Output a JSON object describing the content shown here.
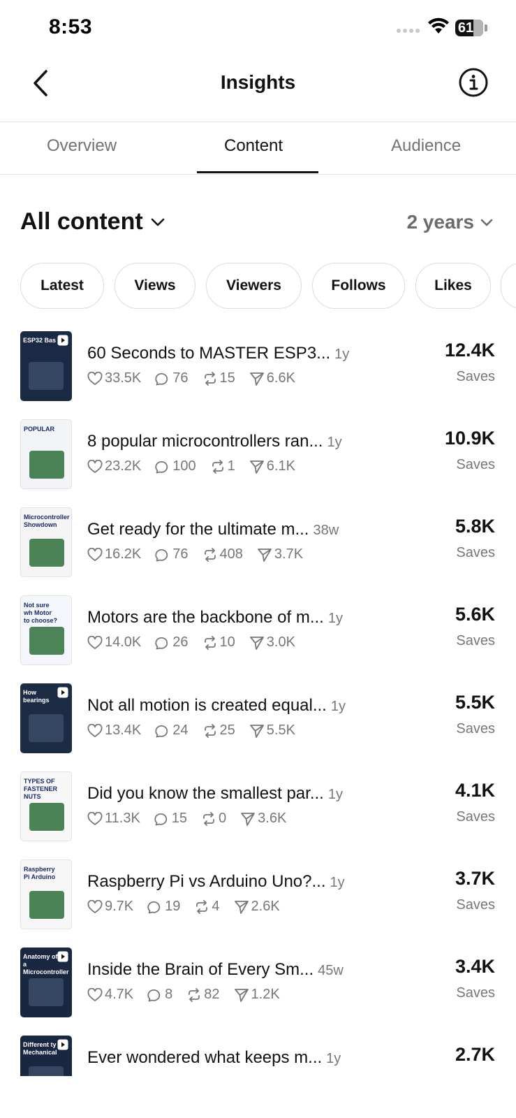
{
  "status": {
    "time": "8:53",
    "battery": "61"
  },
  "header": {
    "title": "Insights"
  },
  "tabs": [
    {
      "label": "Overview"
    },
    {
      "label": "Content"
    },
    {
      "label": "Audience"
    }
  ],
  "section": {
    "title": "All content",
    "range": "2 years"
  },
  "chips": [
    {
      "label": "Latest"
    },
    {
      "label": "Views"
    },
    {
      "label": "Viewers"
    },
    {
      "label": "Follows"
    },
    {
      "label": "Likes"
    }
  ],
  "rows": [
    {
      "title": "60 Seconds to MASTER ESP3...",
      "age": "1y",
      "likes": "33.5K",
      "comments": "76",
      "reposts": "15",
      "shares": "6.6K",
      "value": "12.4K",
      "metric": "Saves",
      "thumb_text": "ESP32 Bas",
      "thumb_bg": "#1b2a44"
    },
    {
      "title": "8 popular microcontrollers ran...",
      "age": "1y",
      "likes": "23.2K",
      "comments": "100",
      "reposts": "1",
      "shares": "6.1K",
      "value": "10.9K",
      "metric": "Saves",
      "thumb_text": "POPULAR",
      "thumb_bg": "#f2f4f7"
    },
    {
      "title": "Get ready for the ultimate m...",
      "age": "38w",
      "likes": "16.2K",
      "comments": "76",
      "reposts": "408",
      "shares": "3.7K",
      "value": "5.8K",
      "metric": "Saves",
      "thumb_text": "Microcontroller Showdown",
      "thumb_bg": "#f5f5f5"
    },
    {
      "title": "Motors are the backbone of m...",
      "age": "1y",
      "likes": "14.0K",
      "comments": "26",
      "reposts": "10",
      "shares": "3.0K",
      "value": "5.6K",
      "metric": "Saves",
      "thumb_text": "Not sure wh Motor to choose?",
      "thumb_bg": "#f3f6fb"
    },
    {
      "title": "Not all motion is created equal...",
      "age": "1y",
      "likes": "13.4K",
      "comments": "24",
      "reposts": "25",
      "shares": "5.5K",
      "value": "5.5K",
      "metric": "Saves",
      "thumb_text": "How bearings",
      "thumb_bg": "#1c2c44"
    },
    {
      "title": "Did you know the smallest par...",
      "age": "1y",
      "likes": "11.3K",
      "comments": "15",
      "reposts": "0",
      "shares": "3.6K",
      "value": "4.1K",
      "metric": "Saves",
      "thumb_text": "TYPES OF FASTENER NUTS",
      "thumb_bg": "#f7f7f7"
    },
    {
      "title": "Raspberry Pi vs Arduino Uno?...",
      "age": "1y",
      "likes": "9.7K",
      "comments": "19",
      "reposts": "4",
      "shares": "2.6K",
      "value": "3.7K",
      "metric": "Saves",
      "thumb_text": "Raspberry Pi Arduino",
      "thumb_bg": "#f7f7f7"
    },
    {
      "title": "Inside the Brain of Every Sm...",
      "age": "45w",
      "likes": "4.7K",
      "comments": "8",
      "reposts": "82",
      "shares": "1.2K",
      "value": "3.4K",
      "metric": "Saves",
      "thumb_text": "Anatomy of a Microcontroller",
      "thumb_bg": "#1a2740"
    },
    {
      "title": "Ever wondered what keeps m...",
      "age": "1y",
      "likes": "",
      "comments": "",
      "reposts": "",
      "shares": "",
      "value": "2.7K",
      "metric": "",
      "thumb_text": "Different ty Mechanical",
      "thumb_bg": "#1a2740"
    }
  ]
}
